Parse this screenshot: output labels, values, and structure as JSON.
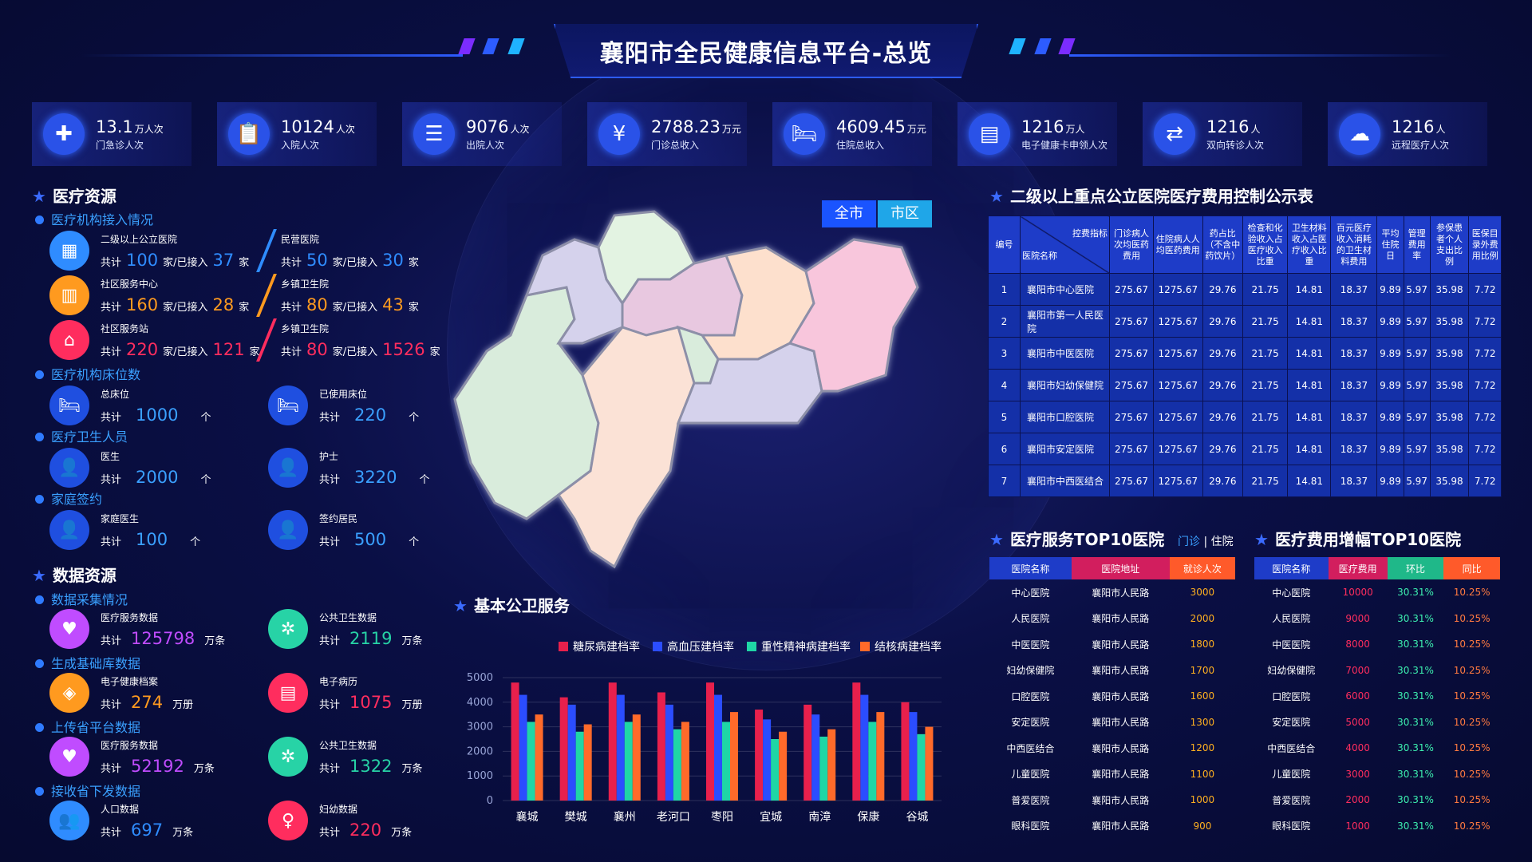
{
  "title": "襄阳市全民健康信息平台-总览",
  "kpis": [
    {
      "value": "13.1",
      "unit": "万人次",
      "label": "门急诊人次",
      "icon": "medical-cross-icon"
    },
    {
      "value": "10124",
      "unit": "人次",
      "label": "入院人次",
      "icon": "clipboard-icon"
    },
    {
      "value": "9076",
      "unit": "人次",
      "label": "出院人次",
      "icon": "document-icon"
    },
    {
      "value": "2788.23",
      "unit": "万元",
      "label": "门诊总收入",
      "icon": "coins-icon"
    },
    {
      "value": "4609.45",
      "unit": "万元",
      "label": "住院总收入",
      "icon": "hospital-bed-icon"
    },
    {
      "value": "1216",
      "unit": "万人",
      "label": "电子健康卡申领人次",
      "icon": "id-card-icon"
    },
    {
      "value": "1216",
      "unit": "人",
      "label": "双向转诊人次",
      "icon": "transfer-icon"
    },
    {
      "value": "1216",
      "unit": "人",
      "label": "远程医疗人次",
      "icon": "cloud-icon"
    }
  ],
  "resources": {
    "title": "医疗资源",
    "access_title": "医疗机构接入情况",
    "access": [
      {
        "name": "二级以上公立医院",
        "total": "100",
        "connected": "37",
        "color": "#2f8cff",
        "icon": "building-icon"
      },
      {
        "name": "民营医院",
        "total": "50",
        "connected": "30",
        "color": "#2f8cff"
      },
      {
        "name": "社区服务中心",
        "total": "160",
        "connected": "28",
        "color": "#ff9a1f",
        "icon": "office-icon"
      },
      {
        "name": "乡镇卫生院",
        "total": "80",
        "connected": "43",
        "color": "#ff9a1f"
      },
      {
        "name": "社区服务站",
        "total": "220",
        "connected": "121",
        "color": "#ff2d5e",
        "icon": "home-medical-icon"
      },
      {
        "name": "乡镇卫生院",
        "total": "80",
        "connected": "1526",
        "color": "#ff2d5e"
      }
    ],
    "total_word": "共计",
    "connected_word": "家/已接入",
    "unit_jia": "家",
    "beds_title": "医疗机构床位数",
    "beds": [
      {
        "name": "总床位",
        "value": "1000",
        "unit": "个"
      },
      {
        "name": "已使用床位",
        "value": "220",
        "unit": "个"
      }
    ],
    "staff_title": "医疗卫生人员",
    "staff": [
      {
        "name": "医生",
        "value": "2000",
        "unit": "个"
      },
      {
        "name": "护士",
        "value": "3220",
        "unit": "个"
      }
    ],
    "sign_title": "家庭签约",
    "sign": [
      {
        "name": "家庭医生",
        "value": "100",
        "unit": "个"
      },
      {
        "name": "签约居民",
        "value": "500",
        "unit": "个"
      }
    ]
  },
  "data_res": {
    "title": "数据资源",
    "groups": [
      {
        "title": "数据采集情况",
        "items": [
          {
            "name": "医疗服务数据",
            "value": "125798",
            "unit": "万条",
            "color": "#c04cff",
            "icon": "stethoscope-icon"
          },
          {
            "name": "公共卫生数据",
            "value": "2119",
            "unit": "万条",
            "color": "#27d3a6",
            "icon": "public-health-icon"
          }
        ]
      },
      {
        "title": "生成基础库数据",
        "items": [
          {
            "name": "电子健康档案",
            "value": "274",
            "unit": "万册",
            "color": "#ff9a1f",
            "icon": "health-record-icon"
          },
          {
            "name": "电子病历",
            "value": "1075",
            "unit": "万册",
            "color": "#ff2d5e",
            "icon": "medical-record-icon"
          }
        ]
      },
      {
        "title": "上传省平台数据",
        "items": [
          {
            "name": "医疗服务数据",
            "value": "52192",
            "unit": "万条",
            "color": "#c04cff",
            "icon": "stethoscope-icon"
          },
          {
            "name": "公共卫生数据",
            "value": "1322",
            "unit": "万条",
            "color": "#27d3a6",
            "icon": "public-health-icon"
          }
        ]
      },
      {
        "title": "接收省下发数据",
        "items": [
          {
            "name": "人口数据",
            "value": "697",
            "unit": "万条",
            "color": "#2f8cff",
            "icon": "population-icon"
          },
          {
            "name": "妇幼数据",
            "value": "220",
            "unit": "万条",
            "color": "#ff2d5e",
            "icon": "maternal-icon"
          }
        ]
      }
    ]
  },
  "map": {
    "btn_all": "全市",
    "btn_city": "市区"
  },
  "services": {
    "title": "基本公卫服务",
    "chart_data": {
      "type": "bar",
      "categories": [
        "襄城",
        "樊城",
        "襄州",
        "老河口",
        "枣阳",
        "宜城",
        "南漳",
        "保康",
        "谷城"
      ],
      "series": [
        {
          "name": "糖尿病建档率",
          "color": "#e8204c",
          "values": [
            4800,
            4200,
            4800,
            4400,
            4800,
            3700,
            3900,
            4800,
            4000
          ]
        },
        {
          "name": "高血压建档率",
          "color": "#2b4dff",
          "values": [
            4300,
            3900,
            4300,
            3900,
            4300,
            3300,
            3500,
            4300,
            3600
          ]
        },
        {
          "name": "重性精神病建档率",
          "color": "#1fd6a6",
          "values": [
            3200,
            2800,
            3200,
            2900,
            3200,
            2500,
            2600,
            3200,
            2700
          ]
        },
        {
          "name": "结核病建档率",
          "color": "#ff6a2a",
          "values": [
            3500,
            3100,
            3500,
            3200,
            3600,
            2800,
            2900,
            3600,
            3000
          ]
        }
      ],
      "ylim": [
        0,
        5000
      ],
      "yticks": [
        "5000",
        "4000",
        "3000",
        "2000",
        "1000",
        "0"
      ],
      "grid": true,
      "legend": "top"
    }
  },
  "cost_table": {
    "title": "二级以上重点公立医院医疗费用控制公示表",
    "h_no": "编号",
    "h_indicator": "控费指标",
    "h_hospital": "医院名称",
    "cols": [
      "门诊病人次均医药费用",
      "住院病人人均医药费用",
      "药占比（不含中药饮片）",
      "检查和化验收入占医疗收入比重",
      "卫生材料收入占医疗收入比重",
      "百元医疗收入消耗的卫生材料费用",
      "平均住院日",
      "管理费用率",
      "参保患者个人支出比例",
      "医保目录外费用比例"
    ],
    "rows": [
      {
        "no": "1",
        "name": "襄阳市中心医院",
        "vals": [
          "275.67",
          "1275.67",
          "29.76",
          "21.75",
          "14.81",
          "18.37",
          "9.89",
          "5.97",
          "35.98",
          "7.72"
        ]
      },
      {
        "no": "2",
        "name": "襄阳市第一人民医院",
        "vals": [
          "275.67",
          "1275.67",
          "29.76",
          "21.75",
          "14.81",
          "18.37",
          "9.89",
          "5.97",
          "35.98",
          "7.72"
        ]
      },
      {
        "no": "3",
        "name": "襄阳市中医医院",
        "vals": [
          "275.67",
          "1275.67",
          "29.76",
          "21.75",
          "14.81",
          "18.37",
          "9.89",
          "5.97",
          "35.98",
          "7.72"
        ]
      },
      {
        "no": "4",
        "name": "襄阳市妇幼保健院",
        "vals": [
          "275.67",
          "1275.67",
          "29.76",
          "21.75",
          "14.81",
          "18.37",
          "9.89",
          "5.97",
          "35.98",
          "7.72"
        ]
      },
      {
        "no": "5",
        "name": "襄阳市口腔医院",
        "vals": [
          "275.67",
          "1275.67",
          "29.76",
          "21.75",
          "14.81",
          "18.37",
          "9.89",
          "5.97",
          "35.98",
          "7.72"
        ]
      },
      {
        "no": "6",
        "name": "襄阳市安定医院",
        "vals": [
          "275.67",
          "1275.67",
          "29.76",
          "21.75",
          "14.81",
          "18.37",
          "9.89",
          "5.97",
          "35.98",
          "7.72"
        ]
      },
      {
        "no": "7",
        "name": "襄阳市中西医结合",
        "vals": [
          "275.67",
          "1275.67",
          "29.76",
          "21.75",
          "14.81",
          "18.37",
          "9.89",
          "5.97",
          "35.98",
          "7.72"
        ]
      }
    ]
  },
  "top_service": {
    "title": "医疗服务TOP10医院",
    "tab_outpatient": "门诊",
    "tab_sep": "|",
    "tab_inpatient": "住院",
    "headers": [
      "医院名称",
      "医院地址",
      "就诊人次"
    ],
    "rows": [
      [
        "中心医院",
        "襄阳市人民路",
        "3000"
      ],
      [
        "人民医院",
        "襄阳市人民路",
        "2000"
      ],
      [
        "中医医院",
        "襄阳市人民路",
        "1800"
      ],
      [
        "妇幼保健院",
        "襄阳市人民路",
        "1700"
      ],
      [
        "口腔医院",
        "襄阳市人民路",
        "1600"
      ],
      [
        "安定医院",
        "襄阳市人民路",
        "1300"
      ],
      [
        "中西医结合",
        "襄阳市人民路",
        "1200"
      ],
      [
        "儿童医院",
        "襄阳市人民路",
        "1100"
      ],
      [
        "普爱医院",
        "襄阳市人民路",
        "1000"
      ],
      [
        "眼科医院",
        "襄阳市人民路",
        "900"
      ]
    ]
  },
  "top_cost": {
    "title": "医疗费用增幅TOP10医院",
    "headers": [
      "医院名称",
      "医疗费用",
      "环比",
      "同比"
    ],
    "rows": [
      [
        "中心医院",
        "10000",
        "30.31%",
        "10.25%"
      ],
      [
        "人民医院",
        "9000",
        "30.31%",
        "10.25%"
      ],
      [
        "中医医院",
        "8000",
        "30.31%",
        "10.25%"
      ],
      [
        "妇幼保健院",
        "7000",
        "30.31%",
        "10.25%"
      ],
      [
        "口腔医院",
        "6000",
        "30.31%",
        "10.25%"
      ],
      [
        "安定医院",
        "5000",
        "30.31%",
        "10.25%"
      ],
      [
        "中西医结合",
        "4000",
        "30.31%",
        "10.25%"
      ],
      [
        "儿童医院",
        "3000",
        "30.31%",
        "10.25%"
      ],
      [
        "普爱医院",
        "2000",
        "30.31%",
        "10.25%"
      ],
      [
        "眼科医院",
        "1000",
        "30.31%",
        "10.25%"
      ]
    ]
  }
}
